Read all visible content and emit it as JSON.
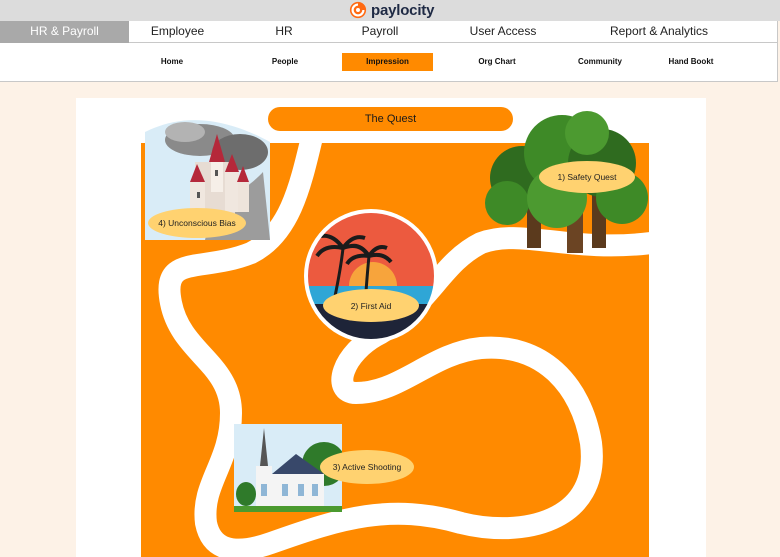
{
  "brand": {
    "name": "paylocity",
    "icon": "paylocity-logo-icon",
    "color": "#ff6a13"
  },
  "main_nav": {
    "items": [
      {
        "label": "HR & Payroll",
        "active": true
      },
      {
        "label": "Employee",
        "active": false
      },
      {
        "label": "HR",
        "active": false
      },
      {
        "label": "Payroll",
        "active": false
      },
      {
        "label": "User Access",
        "active": false
      },
      {
        "label": "Report & Analytics",
        "active": false
      }
    ]
  },
  "sub_nav": {
    "items": [
      {
        "label": "Home",
        "active": false
      },
      {
        "label": "People",
        "active": false
      },
      {
        "label": "Impression",
        "active": true
      },
      {
        "label": "Org Chart",
        "active": false
      },
      {
        "label": "Community",
        "active": false
      },
      {
        "label": "Hand Bookt",
        "active": false
      }
    ]
  },
  "quest": {
    "title": "The Quest",
    "stops": [
      {
        "label": "1) Safety Quest",
        "icon": "oak-tree-icon"
      },
      {
        "label": "2) First Aid",
        "icon": "sunset-island-icon"
      },
      {
        "label": "3) Active Shooting",
        "icon": "church-icon"
      },
      {
        "label": "4) Unconscious Bias",
        "icon": "castle-icon"
      }
    ]
  },
  "colors": {
    "accent": "#ff8a00",
    "label_fill": "#ffd270",
    "nav_active": "#a9a9a9",
    "page_bg": "#fdf2e7"
  }
}
